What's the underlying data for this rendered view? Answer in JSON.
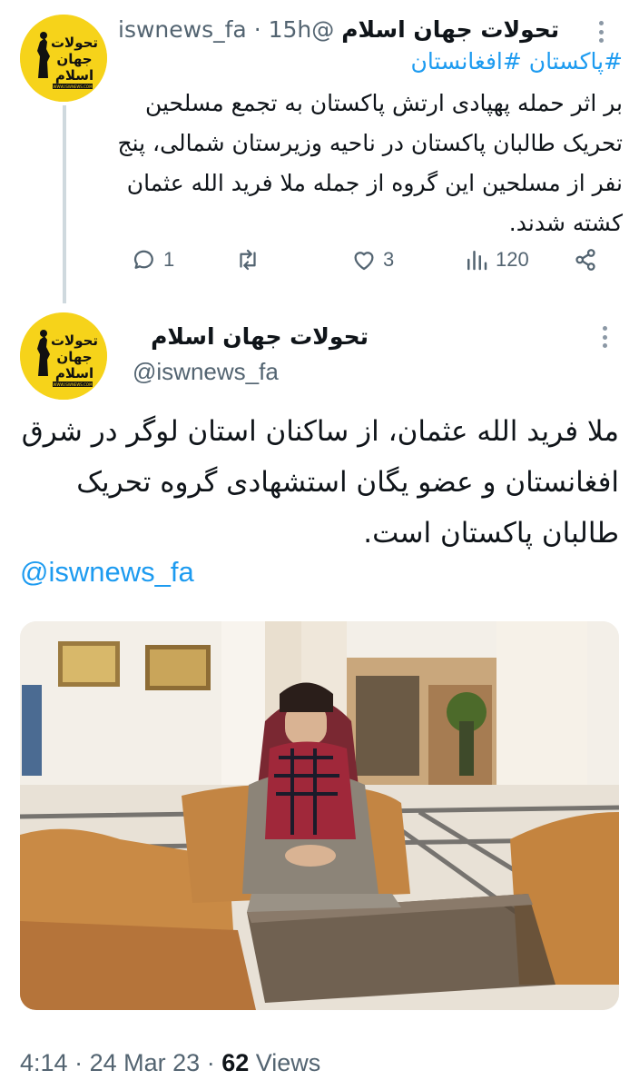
{
  "tweet1": {
    "author_name": "تحولات جهان اسلام",
    "handle": "@iswnews_fa",
    "separator": "·",
    "time": "15h",
    "hashtags": "#پاکستان #افغانستان",
    "body": "بر اثر حمله پهپادی ارتش پاکستان به تجمع مسلحین تحریک طالبان پاکستان در ناحیه وزیرستان شمالی، پنج نفر از مسلحین این گروه از جمله ملا فرید الله عثمان کشته شدند.",
    "replies": "1",
    "likes": "3",
    "views": "120",
    "reply_icon": "reply-icon",
    "retweet_icon": "retweet-icon",
    "like_icon": "heart-icon",
    "views_icon": "views-bar-icon",
    "share_icon": "share-icon"
  },
  "avatar": {
    "logo_text_line1": "تحولات",
    "logo_text_line2": "جهان",
    "logo_text_line3": "اسلام",
    "logo_url": "WWW.ISWNEWS.COM",
    "bg_color": "#f6d31a"
  },
  "tweet2": {
    "author_name": "تحولات جهان اسلام",
    "handle": "@iswnews_fa",
    "body": "ملا فرید الله عثمان، از ساکنان استان لوگر در شرق افغانستان و عضو یگان استشهادی گروه تحریک طالبان پاکستان است.",
    "mention": "@iswnews_fa"
  },
  "footer": {
    "time": "4:14",
    "separator": "·",
    "date": "24 Mar 23",
    "views_count": "62",
    "views_label": "Views"
  },
  "colors": {
    "link": "#1d9bf0",
    "muted": "#536471",
    "text": "#0f1419"
  }
}
